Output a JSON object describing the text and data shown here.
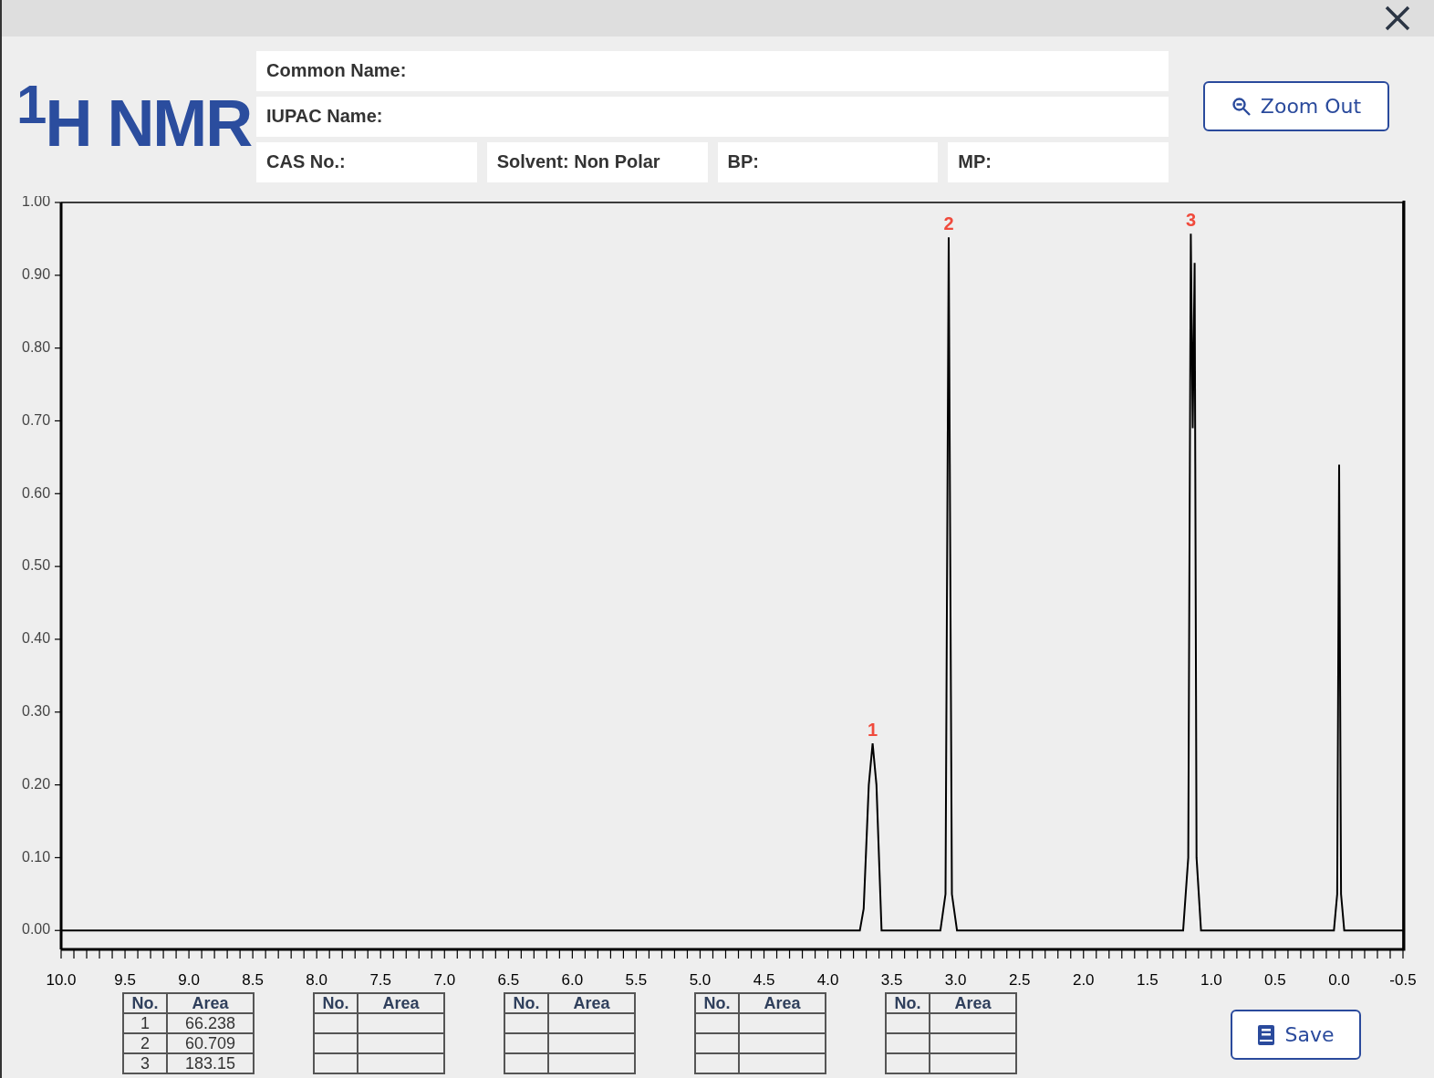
{
  "header": {
    "logo": "$^{1}$H NMR",
    "fields": [
      {
        "label": "Common Name:"
      },
      {
        "label": "IUPAC Name:"
      },
      {
        "label": "CAS No.:"
      },
      {
        "label": "Solvent: Non Polar"
      },
      {
        "label": "BP:"
      },
      {
        "label": "MP:"
      }
    ],
    "zoom_button": "Zoom Out"
  },
  "spectrum": {
    "chart_data": {
      "type": "line",
      "x": [
        10.0,
        3.75,
        3.72,
        3.68,
        3.65,
        3.62,
        3.58,
        3.12,
        3.08,
        3.055,
        3.03,
        2.99,
        1.22,
        1.18,
        1.16,
        1.145,
        1.13,
        1.115,
        1.08,
        0.04,
        0.015,
        0.0,
        -0.015,
        -0.04,
        -0.5
      ],
      "series": [
        {
          "color": "#000000",
          "values": [
            0.0,
            0.0,
            0.03,
            0.2,
            0.257,
            0.2,
            0.0,
            0.0,
            0.05,
            0.952,
            0.05,
            0.0,
            0.0,
            0.1,
            0.957,
            0.69,
            0.917,
            0.1,
            0.0,
            0.0,
            0.05,
            0.64,
            0.05,
            0.0,
            0.0
          ]
        }
      ],
      "xlim": [
        10.0,
        -0.5
      ],
      "ylim": [
        -0.026,
        1
      ],
      "xticks": [
        {
          "value": 10,
          "label": "10.0"
        },
        {
          "value": 9.5,
          "label": "9.5"
        },
        {
          "value": 9,
          "label": "9.0"
        },
        {
          "value": 8.5,
          "label": "8.5"
        },
        {
          "value": 8,
          "label": "8.0"
        },
        {
          "value": 7.5,
          "label": "7.5"
        },
        {
          "value": 7,
          "label": "7.0"
        },
        {
          "value": 6.5,
          "label": "6.5"
        },
        {
          "value": 6,
          "label": "6.0"
        },
        {
          "value": 5.5,
          "label": "5.5"
        },
        {
          "value": 5,
          "label": "5.0"
        },
        {
          "value": 4.5,
          "label": "4.5"
        },
        {
          "value": 4,
          "label": "4.0"
        },
        {
          "value": 3.5,
          "label": "3.5"
        },
        {
          "value": 3,
          "label": "3.0"
        },
        {
          "value": 2.5,
          "label": "2.5"
        },
        {
          "value": 2,
          "label": "2.0"
        },
        {
          "value": 1.5,
          "label": "1.5"
        },
        {
          "value": 1,
          "label": "1.0"
        },
        {
          "value": 0.5,
          "label": "0.5"
        },
        {
          "value": 0,
          "label": "0.0"
        },
        {
          "value": -0.5,
          "label": "-0.5"
        }
      ],
      "yticks": [
        {
          "value": 1,
          "label": "1.00"
        },
        {
          "value": 0.9,
          "label": "0.90"
        },
        {
          "value": 0.8,
          "label": "0.80"
        },
        {
          "value": 0.7,
          "label": "0.70"
        },
        {
          "value": 0.6,
          "label": "0.60"
        },
        {
          "value": 0.5,
          "label": "0.50"
        },
        {
          "value": 0.4,
          "label": "0.40"
        },
        {
          "value": 0.3,
          "label": "0.30"
        },
        {
          "value": 0.2,
          "label": "0.20"
        },
        {
          "value": 0.1,
          "label": "0.10"
        },
        {
          "value": 0,
          "label": "0.00"
        }
      ],
      "annotations": [
        {
          "x": 3.65,
          "y": 0.257,
          "text": "1"
        },
        {
          "x": 3.055,
          "y": 0.952,
          "text": "2"
        },
        {
          "x": 1.16,
          "y": 0.957,
          "text": "3"
        }
      ]
    }
  },
  "area_tables": [
    {
      "columns": [
        "No.",
        "Area"
      ],
      "rows": [
        [
          "1",
          "66.238"
        ],
        [
          "2",
          "60.709"
        ],
        [
          "3",
          "183.15"
        ]
      ]
    },
    {
      "columns": [
        "No.",
        "Area"
      ]
    },
    {
      "columns": [
        "No.",
        "Area"
      ]
    },
    {
      "columns": [
        "No.",
        "Area"
      ]
    },
    {
      "columns": [
        "No.",
        "Area"
      ]
    }
  ],
  "save_button": "Save"
}
